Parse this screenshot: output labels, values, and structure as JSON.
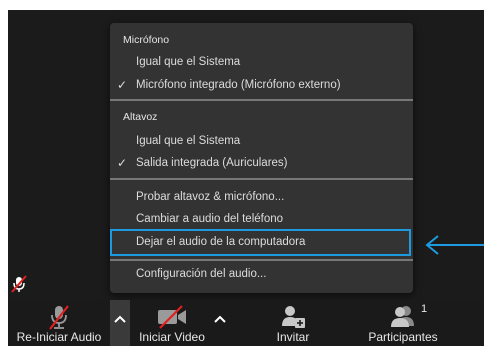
{
  "audio_menu": {
    "microphone": {
      "header": "Micrófono",
      "items": [
        {
          "label": "Igual que el Sistema",
          "checked": false
        },
        {
          "label": "Micrófono integrado (Micrófono externo)",
          "checked": true
        }
      ]
    },
    "speaker": {
      "header": "Altavoz",
      "items": [
        {
          "label": "Igual que el Sistema",
          "checked": false
        },
        {
          "label": "Salida integrada (Auriculares)",
          "checked": true
        }
      ]
    },
    "actions": [
      {
        "label": "Probar altavoz & micrófono..."
      },
      {
        "label": "Cambiar a audio del teléfono"
      },
      {
        "label": "Dejar el audio de la computadora"
      }
    ],
    "settings_label": "Configuración del audio...",
    "check_glyph": "✓",
    "highlight_color": "#1e9be0"
  },
  "toolbar": {
    "audio_label": "Re-Iniciar Audio",
    "video_label": "Iniciar Video",
    "invite_label": "Invitar",
    "participants_label": "Participantes",
    "participants_count": "1"
  },
  "icons": {
    "audio": "microphone-muted-icon",
    "video": "video-camera-off-icon",
    "invite": "add-user-icon",
    "participants": "participants-icon",
    "chevron": "chevron-up-icon",
    "arrow": "left-arrow-icon"
  }
}
